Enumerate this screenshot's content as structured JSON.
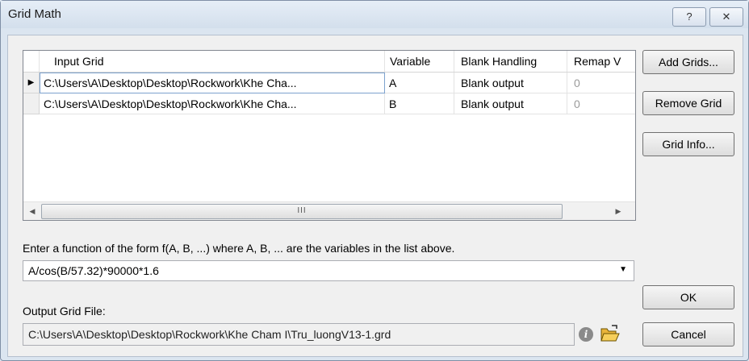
{
  "window": {
    "title": "Grid Math",
    "help_label": "?",
    "close_label": "✕"
  },
  "grid": {
    "columns": [
      "Input Grid",
      "Variable",
      "Blank Handling",
      "Remap V"
    ],
    "rows": [
      {
        "input_grid": "C:\\Users\\A\\Desktop\\Desktop\\Rockwork\\Khe Cha...",
        "variable": "A",
        "blank_handling": "Blank output",
        "remap": "0"
      },
      {
        "input_grid": "C:\\Users\\A\\Desktop\\Desktop\\Rockwork\\Khe Cha...",
        "variable": "B",
        "blank_handling": "Blank output",
        "remap": "0"
      }
    ],
    "scroll_left": "◀",
    "scroll_right": "▶",
    "scroll_thumb": "III"
  },
  "buttons": {
    "add_grids": "Add Grids...",
    "remove_grid": "Remove Grid",
    "grid_info": "Grid Info...",
    "ok": "OK",
    "cancel": "Cancel"
  },
  "function": {
    "prompt": "Enter a function of the form f(A, B, ...) where A, B, ... are the variables in the list above.",
    "value": "A/cos(B/57.32)*90000*1.6"
  },
  "output": {
    "label": "Output Grid File:",
    "value": "C:\\Users\\A\\Desktop\\Desktop\\Rockwork\\Khe Cham I\\Tru_luongV13-1.grd"
  },
  "icons": {
    "info": "info-icon",
    "folder": "open-folder-icon"
  }
}
